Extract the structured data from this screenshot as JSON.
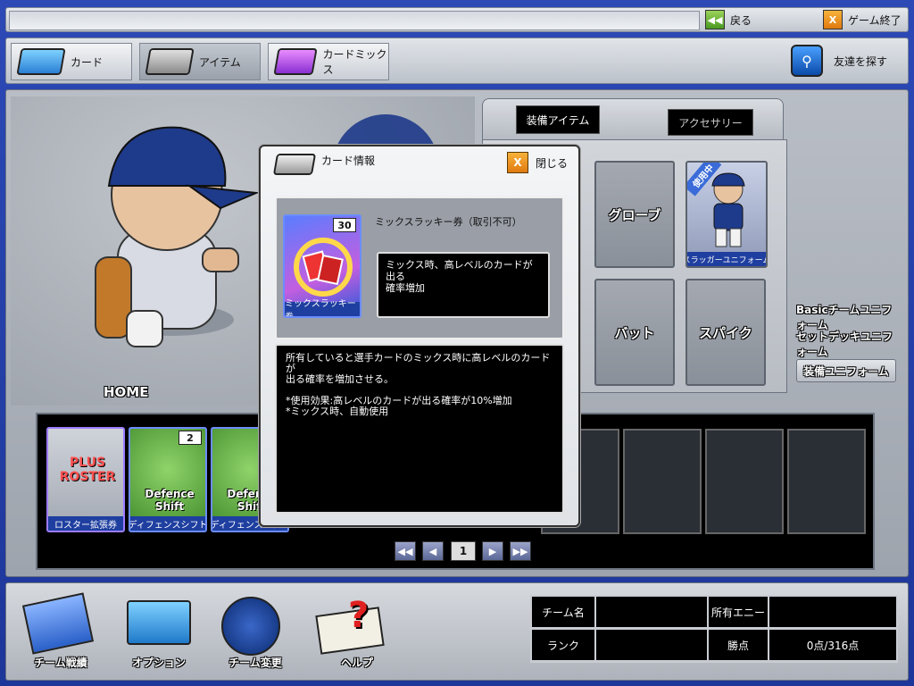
{
  "topbar": {
    "back_label": "戻る",
    "exit_label": "ゲーム終了",
    "exit_icon_text": "X"
  },
  "nav": {
    "tabs": [
      {
        "label": "カード",
        "active": false
      },
      {
        "label": "アイテム",
        "active": true
      },
      {
        "label": "カードミックス",
        "active": false
      }
    ],
    "find_friends": "友達を探す"
  },
  "player": {
    "home_label": "HOME"
  },
  "equip": {
    "tabs": [
      "装備アイテム",
      "アクセサリー"
    ],
    "slots": [
      "グローブ",
      "バット",
      "スパイク"
    ],
    "uniform_card": {
      "badge": "使用中",
      "name": "スラッガーユニフォーム"
    },
    "uniform_options": [
      "Basicチームユニフォーム",
      "セットデッキユニフォーム",
      "装備ユニフォーム"
    ],
    "selected_uniform_option": "装備ユニフォーム"
  },
  "items": {
    "cards": [
      {
        "name": "ロスター拡張券",
        "art": "PLUS ROSTER",
        "count": ""
      },
      {
        "name": "ディフェンスシフト",
        "art": "Defence Shift",
        "count": "2"
      },
      {
        "name": "ディフェンスシフト",
        "art": "Defence Shift",
        "count": ""
      }
    ],
    "page": "1"
  },
  "bottom": {
    "buttons": [
      "チーム戦績",
      "オプション",
      "チーム変更",
      "ヘルプ"
    ],
    "stats": {
      "team_name_label": "チーム名",
      "team_name_value": "",
      "money_label": "所有エニー",
      "money_value": "",
      "rank_label": "ランク",
      "rank_value": "",
      "points_label": "勝点",
      "points_value": "0点/316点"
    }
  },
  "modal": {
    "title": "カード情報",
    "close_label": "閉じる",
    "close_icon_text": "X",
    "item": {
      "name": "ミックスラッキー券（取引不可）",
      "card_name": "ミックスラッキー券",
      "count": "30",
      "short_desc": "ミックス時、高レベルのカードが出る\n確率増加",
      "long_desc": "所有していると選手カードのミックス時に高レベルのカードが\n出る確率を増加させる。\n\n*使用効果:高レベルのカードが出る確率が10%増加\n*ミックス時、自動使用"
    }
  },
  "colors": {
    "frame": "#2c49b6",
    "accent_blue": "#1f3fa0",
    "close_orange": "#f0941e"
  }
}
